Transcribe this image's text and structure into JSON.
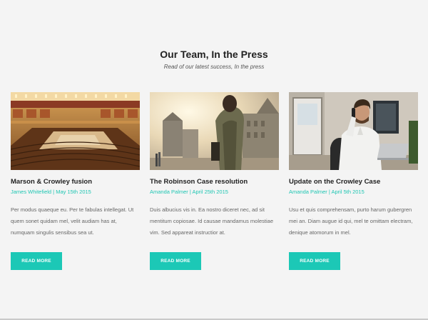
{
  "section": {
    "title": "Our Team, In the Press",
    "subtitle": "Read of our latest success, In the press"
  },
  "cards": [
    {
      "image": "parliament-chamber-photo",
      "title": "Marson & Crowley fusion",
      "meta": "James Whitefield | May 15th 2015",
      "excerpt": "Per modus quaeque eu. Per te fabulas intellegat. Ut quem sonet quidam mel, velit audiam has at, numquam singulis sensibus sea ut.",
      "button": "READ MORE"
    },
    {
      "image": "businessman-walking-city-photo",
      "title": "The Robinson Case resolution",
      "meta": "Amanda Palmer | April 25th 2015",
      "excerpt": "Duis albucius vis in. Ea nostro diceret nec, ad sit mentitum copiosae. Id causae mandamus molestiae vim. Sed appareat instructior at.",
      "button": "READ MORE"
    },
    {
      "image": "man-on-phone-office-photo",
      "title": "Update on the Crowley Case",
      "meta": "Amanda Palmer | April 5th 2015",
      "excerpt": "Usu et quis comprehensam, purto harum gubergren mei an. Diam augue id qui, mel te omittam electram, denique atomorum in mel.",
      "button": "READ MORE"
    }
  ],
  "colors": {
    "accent": "#1cc8b6",
    "meta_text": "#1fc6b3",
    "background": "#f4f4f4"
  }
}
